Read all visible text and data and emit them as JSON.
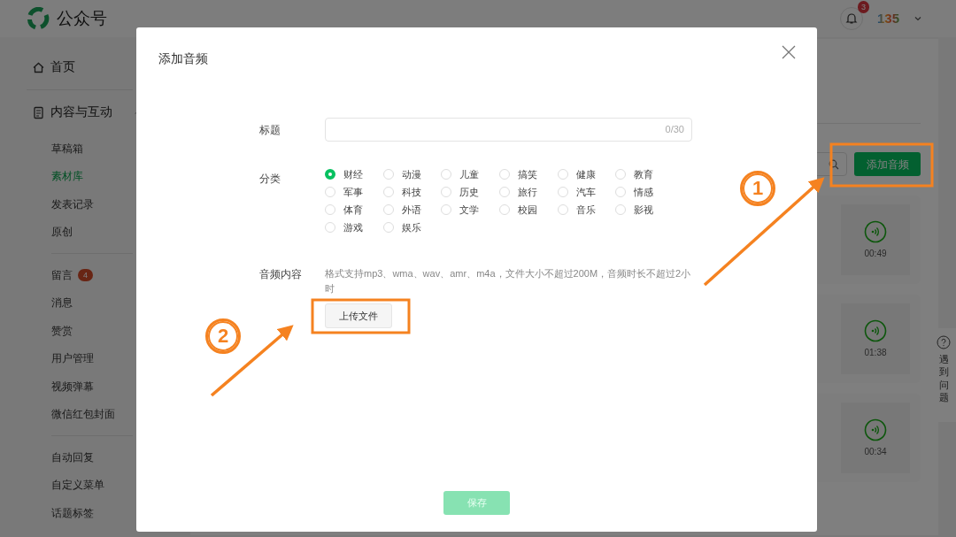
{
  "app": {
    "title": "公众号",
    "notification_count": "3",
    "account_logo": "135"
  },
  "sidebar": [
    {
      "label": "首页",
      "kind": "home"
    },
    {
      "label": "内容与互动",
      "kind": "section",
      "expanded": true,
      "groups": [
        [
          {
            "label": "草稿箱",
            "selected": false
          },
          {
            "label": "素材库",
            "selected": true
          },
          {
            "label": "发表记录",
            "selected": false
          },
          {
            "label": "原创",
            "selected": false
          }
        ],
        [
          {
            "label": "留言",
            "badge": "4",
            "selected": false
          },
          {
            "label": "消息",
            "selected": false
          },
          {
            "label": "赞赏",
            "selected": false
          },
          {
            "label": "用户管理",
            "selected": false
          },
          {
            "label": "视频弹幕",
            "selected": false
          },
          {
            "label": "微信红包封面",
            "selected": false
          }
        ],
        [
          {
            "label": "自动回复",
            "selected": false
          },
          {
            "label": "自定义菜单",
            "selected": false
          },
          {
            "label": "话题标签",
            "selected": false
          }
        ]
      ]
    }
  ],
  "toolbar": {
    "add_button": "添加音频"
  },
  "audio_cards": [
    {
      "duration": "00:49"
    },
    {
      "duration": "01:38"
    },
    {
      "duration": "00:34"
    }
  ],
  "help": {
    "label": "遇到问题"
  },
  "dialog": {
    "title": "添加音频",
    "title_field": {
      "label": "标题",
      "counter": "0/30"
    },
    "category": {
      "label": "分类",
      "options": [
        {
          "label": "财经",
          "selected": true
        },
        {
          "label": "动漫",
          "selected": false
        },
        {
          "label": "儿童",
          "selected": false
        },
        {
          "label": "搞笑",
          "selected": false
        },
        {
          "label": "健康",
          "selected": false
        },
        {
          "label": "教育",
          "selected": false
        },
        {
          "label": "军事",
          "selected": false
        },
        {
          "label": "科技",
          "selected": false
        },
        {
          "label": "历史",
          "selected": false
        },
        {
          "label": "旅行",
          "selected": false
        },
        {
          "label": "汽车",
          "selected": false
        },
        {
          "label": "情感",
          "selected": false
        },
        {
          "label": "体育",
          "selected": false
        },
        {
          "label": "外语",
          "selected": false
        },
        {
          "label": "文学",
          "selected": false
        },
        {
          "label": "校园",
          "selected": false
        },
        {
          "label": "音乐",
          "selected": false
        },
        {
          "label": "影视",
          "selected": false
        },
        {
          "label": "游戏",
          "selected": false
        },
        {
          "label": "娱乐",
          "selected": false
        }
      ]
    },
    "audio": {
      "label": "音频内容",
      "hint": "格式支持mp3、wma、wav、amr、m4a，文件大小不超过200M，音频时长不超过2小时",
      "upload_button": "上传文件"
    },
    "save_button": {
      "label": "保存",
      "disabled": true
    }
  },
  "annotations": [
    {
      "number": "1"
    },
    {
      "number": "2"
    }
  ]
}
